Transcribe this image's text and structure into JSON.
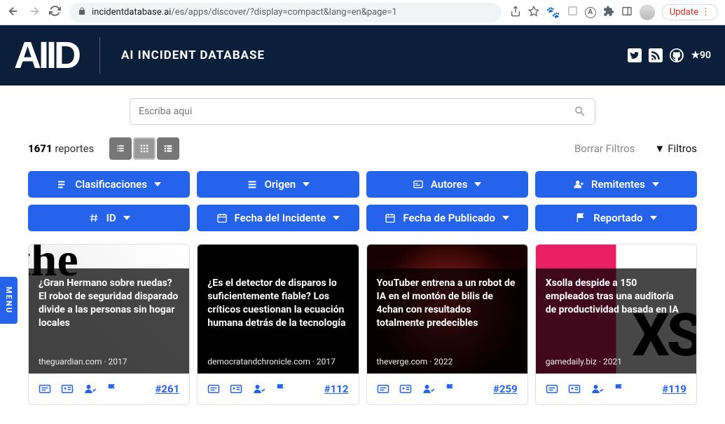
{
  "browser": {
    "url_host": "incidentdatabase.ai",
    "url_path": "/es/apps/discover/?display=compact&lang=en&page=1",
    "update_label": "Update"
  },
  "header": {
    "logo_text": "AIID",
    "title": "AI INCIDENT DATABASE",
    "star_count": "90"
  },
  "search": {
    "placeholder": "Escriba aqui"
  },
  "results": {
    "count": "1671",
    "count_label": "reportes",
    "clear_filters": "Borrar Filtros",
    "filters_label": "Filtros"
  },
  "filters_row1": [
    {
      "label": "Clasificaciones",
      "icon": "tags"
    },
    {
      "label": "Origen",
      "icon": "list"
    },
    {
      "label": "Autores",
      "icon": "card"
    },
    {
      "label": "Remitentes",
      "icon": "user"
    }
  ],
  "filters_row2": [
    {
      "label": "ID",
      "icon": "hash"
    },
    {
      "label": "Fecha del Incidente",
      "icon": "cal"
    },
    {
      "label": "Fecha de Publicado",
      "icon": "cal"
    },
    {
      "label": "Reportado",
      "icon": "flag"
    }
  ],
  "cards": [
    {
      "title": "¿Gran Hermano sobre ruedas? El robot de seguridad disparado divide a las personas sin hogar locales",
      "source": "theguardian.com · 2017",
      "incident": "#261"
    },
    {
      "title": "¿Es el detector de disparos lo suficientemente fiable? Los críticos cuestionan la ecuación humana detrás de la tecnología",
      "source": "democratandchronicle.com · 2017",
      "incident": "#112"
    },
    {
      "title": "YouTuber entrena a un robot de IA en el montón de bilis de 4chan con resultados totalmente predecibles",
      "source": "theverge.com · 2022",
      "incident": "#259"
    },
    {
      "title": "Xsolla despide a 150 empleados tras una auditoría de productividad basada en IA",
      "source": "gamedaily.biz · 2021",
      "incident": "#119"
    }
  ],
  "menu_tab": "MENU"
}
